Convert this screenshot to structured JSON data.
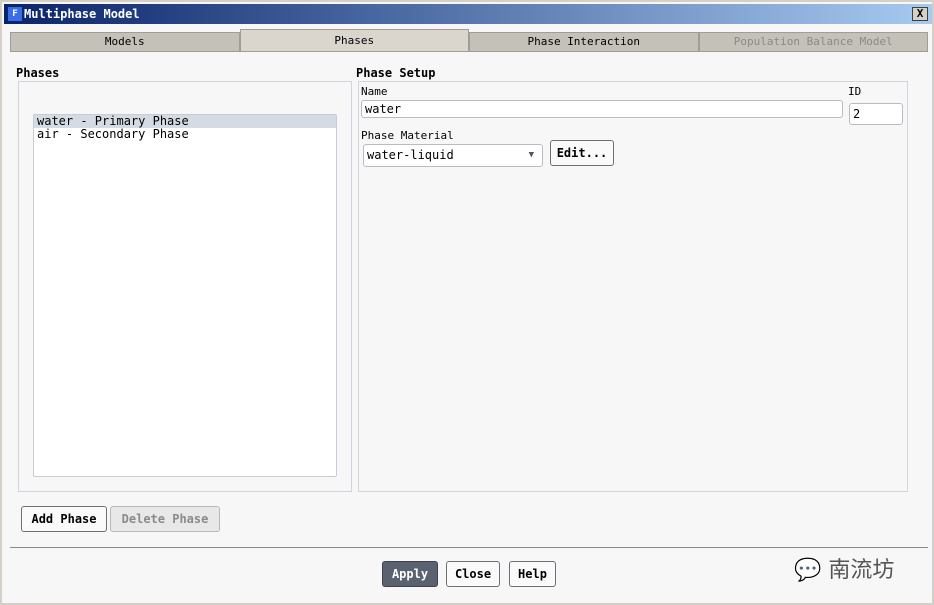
{
  "window": {
    "title": "Multiphase Model",
    "app_icon": "F",
    "close_label": "X"
  },
  "tabs": [
    {
      "label": "Models"
    },
    {
      "label": "Phases"
    },
    {
      "label": "Phase Interaction"
    },
    {
      "label": "Population Balance Model"
    }
  ],
  "phases": {
    "title": "Phases",
    "items": [
      "water - Primary Phase",
      "air - Secondary Phase"
    ],
    "add_label": "Add Phase",
    "delete_label": "Delete Phase"
  },
  "setup": {
    "title": "Phase Setup",
    "name_label": "Name",
    "name_value": "water",
    "id_label": "ID",
    "id_value": "2",
    "material_label": "Phase Material",
    "material_value": "water-liquid",
    "edit_label": "Edit..."
  },
  "footer": {
    "apply": "Apply",
    "close": "Close",
    "help": "Help"
  },
  "watermark": "南流坊"
}
